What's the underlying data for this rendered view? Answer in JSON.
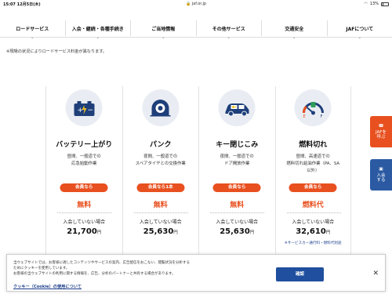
{
  "status_bar": {
    "time": "15:07",
    "date": "12月5日(木)",
    "url": "jaf.or.jp",
    "battery": "13%"
  },
  "nav": {
    "items": [
      {
        "label": "ロードサービス"
      },
      {
        "label": "入会・継続・各種手続き"
      },
      {
        "label": "ご当地情報"
      },
      {
        "label": "その他サービス"
      },
      {
        "label": "交通安全"
      },
      {
        "label": "JAFについて"
      }
    ]
  },
  "notice": "※現場の状況によりロードサービス料金が異なります。",
  "cards": [
    {
      "icon": "car-battery-icon",
      "title": "バッテリー上がり",
      "desc_line1": "昼間、一般道での",
      "desc_line2": "応急始動作業",
      "desc_line3": "",
      "badge": "会員なら",
      "member_price": "無料",
      "nonmember_label": "入会していない場合",
      "price": "21,700",
      "yen": "円",
      "note": ""
    },
    {
      "icon": "flat-tire-icon",
      "title": "パンク",
      "desc_line1": "夜間、一般道での",
      "desc_line2": "スペアタイヤとの交換作業",
      "desc_line3": "",
      "badge": "会員なら1本",
      "member_price": "無料",
      "nonmember_label": "入会していない場合",
      "price": "25,630",
      "yen": "円",
      "note": ""
    },
    {
      "icon": "car-key-lockout-icon",
      "title": "キー閉じこみ",
      "desc_line1": "夜間、一般道での",
      "desc_line2": "ドア開放作業",
      "desc_line3": "",
      "badge": "会員なら",
      "member_price": "無料",
      "nonmember_label": "入会していない場合",
      "price": "25,630",
      "yen": "円",
      "note": ""
    },
    {
      "icon": "fuel-gauge-icon",
      "title": "燃料切れ",
      "desc_line1": "昼間、高速道での",
      "desc_line2": "燃料切れ給油作業（PA、SA",
      "desc_line3": "以外）",
      "badge": "会員なら",
      "member_price": "燃料代",
      "nonmember_label": "入会していない場合",
      "price": "32,610",
      "yen": "円",
      "note": "※サービスカー通行料・燃料代別途"
    }
  ],
  "side_tabs": {
    "call": "JAFを呼ぶ",
    "join": "入会する"
  },
  "cookie": {
    "line1": "当ウェブサイトでは、お客様に適したコンテンツやサービスの案内、広告配信をおこない、閲覧状況を分析する",
    "line2": "ためにクッキーを使用しています。",
    "line3": "お客様の当ウェブサイトの利用に関する情報を、広告、分析のパートナーと共有する場合があります。",
    "link": "クッキー（Cookie）の使用について",
    "confirm": "確認",
    "close": "✕"
  },
  "colors": {
    "accent_red": "#e8501f",
    "brand_blue": "#1f4f9e"
  }
}
